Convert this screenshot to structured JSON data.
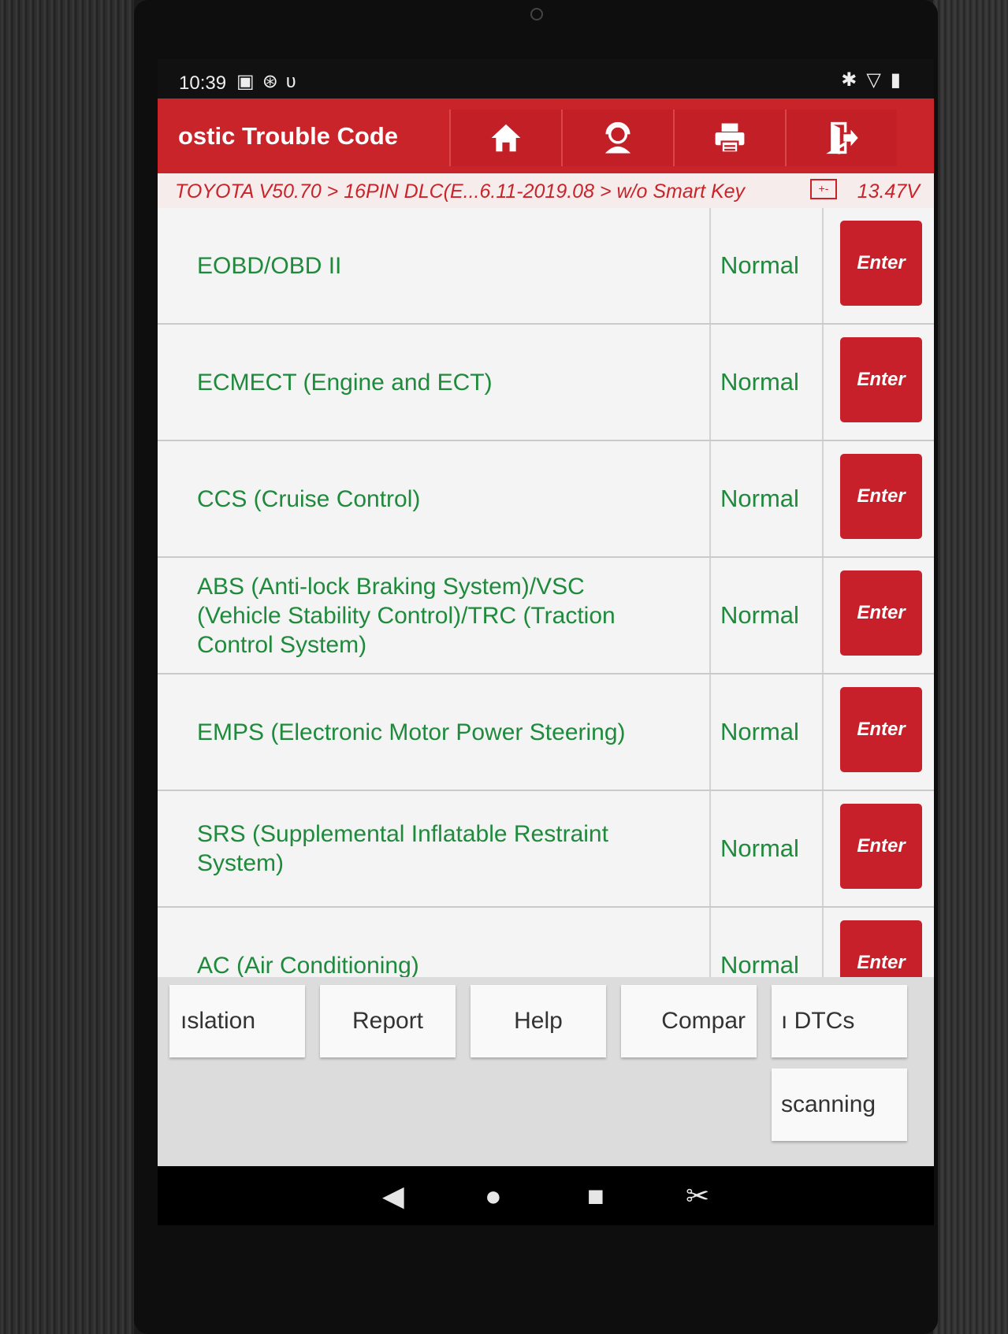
{
  "status_bar": {
    "time": "10:39",
    "left_icons": [
      "image-icon",
      "bluetooth-settings-icon",
      "stethoscope-icon"
    ],
    "right_icons": [
      "bluetooth-icon",
      "wifi-icon",
      "battery-icon"
    ]
  },
  "header": {
    "title": "ostic Trouble Code",
    "buttons": [
      "home-icon",
      "support-agent-icon",
      "printer-icon",
      "exit-icon"
    ],
    "accent_color": "#c8242a"
  },
  "breadcrumb": {
    "path": "TOYOTA V50.70 > 16PIN DLC(E...6.11-2019.08 > w/o Smart Key",
    "battery_icon_text": "+-",
    "voltage": "13.47V"
  },
  "systems": [
    {
      "name": "EOBD/OBD II",
      "status": "Normal",
      "action": "Enter"
    },
    {
      "name": "ECMECT (Engine and ECT)",
      "status": "Normal",
      "action": "Enter"
    },
    {
      "name": "CCS (Cruise Control)",
      "status": "Normal",
      "action": "Enter"
    },
    {
      "name": "ABS (Anti-lock Braking System)/VSC (Vehicle Stability Control)/TRC (Traction Control System)",
      "status": "Normal",
      "action": "Enter"
    },
    {
      "name": "EMPS (Electronic Motor Power Steering)",
      "status": "Normal",
      "action": "Enter"
    },
    {
      "name": "SRS (Supplemental Inflatable Restraint System)",
      "status": "Normal",
      "action": "Enter"
    },
    {
      "name": "AC (Air Conditioning)",
      "status": "Normal",
      "action": "Enter"
    }
  ],
  "bottom_buttons": {
    "translation": "ıslation",
    "report": "Report",
    "help": "Help",
    "compare": "Compar",
    "clear_dtcs": "ı DTCs",
    "scanning": "scanning"
  },
  "nav_bar": [
    "back-icon",
    "home-circle-icon",
    "recents-icon",
    "screenshot-icon"
  ]
}
